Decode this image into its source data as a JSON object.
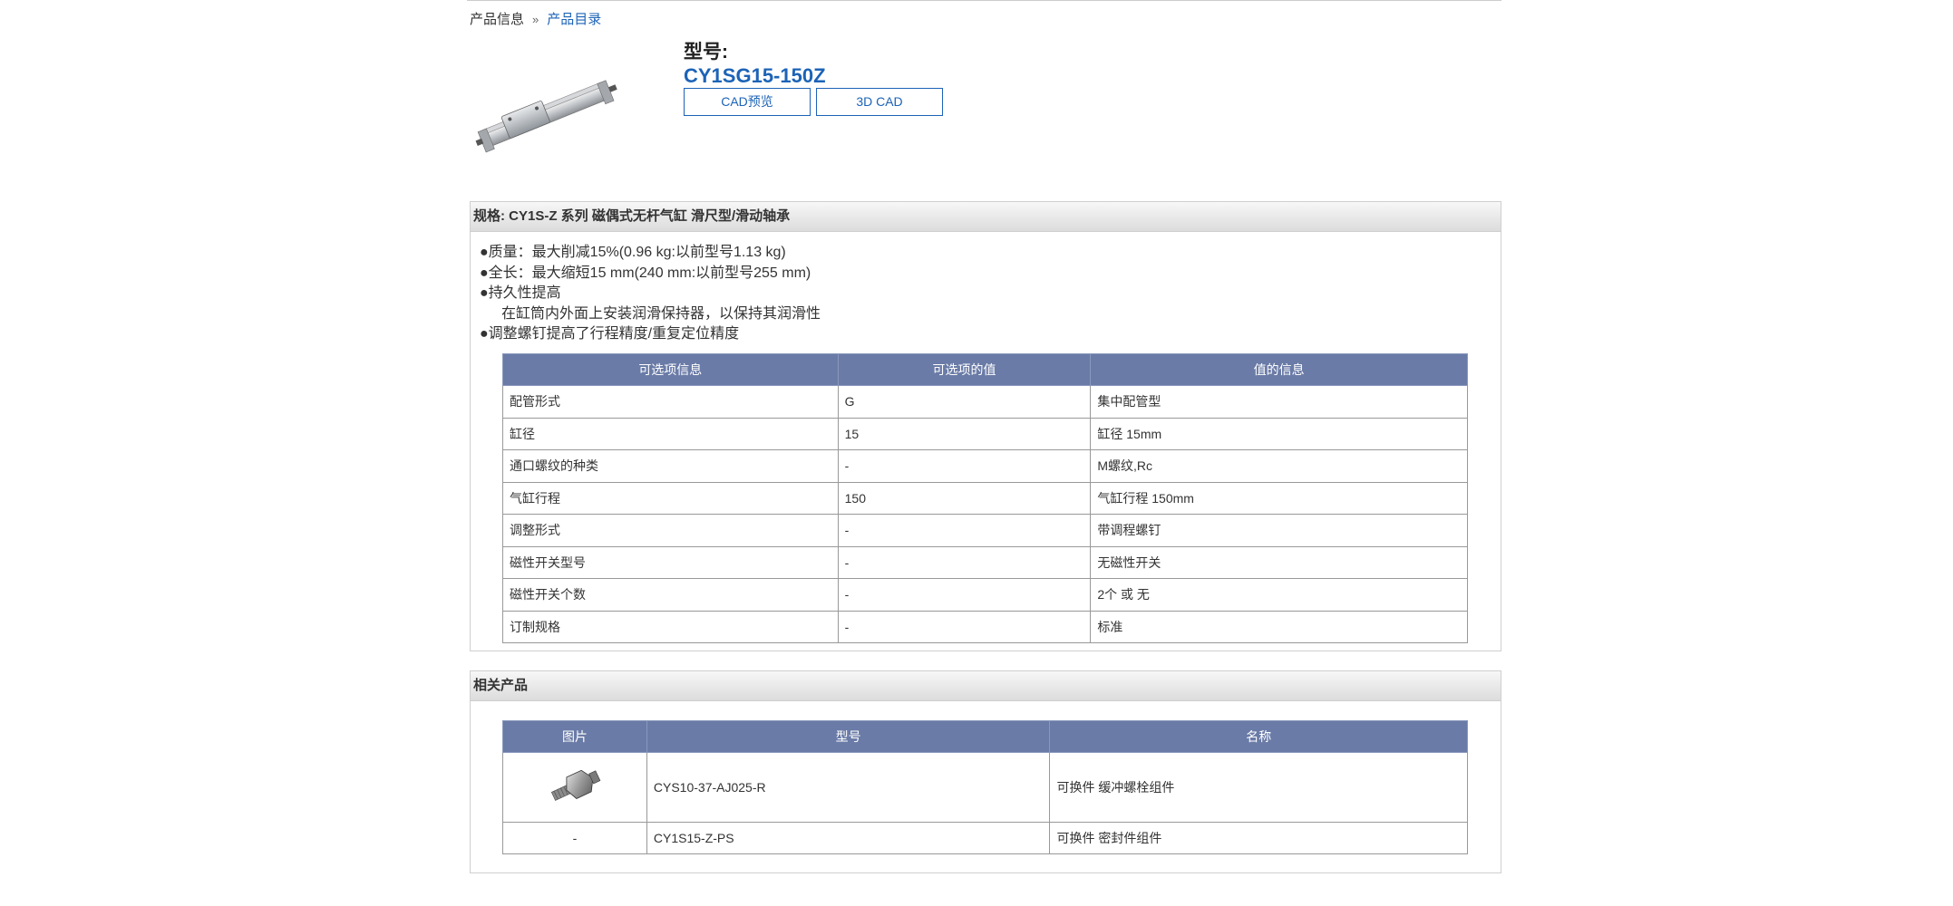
{
  "breadcrumb": {
    "item1": "产品信息",
    "separator": "»",
    "item2": "产品目录"
  },
  "product": {
    "model_label": "型号:",
    "model_number": "CY1SG15-150Z",
    "buttons": {
      "cad_preview": "CAD预览",
      "cad_3d": "3D CAD"
    }
  },
  "spec": {
    "header": "规格: CY1S-Z 系列 磁偶式无杆气缸 滑尺型/滑动轴承",
    "features": [
      "●质量：最大削减15%(0.96 kg:以前型号1.13 kg)",
      "●全长：最大缩短15 mm(240 mm:以前型号255 mm)",
      "●持久性提高",
      "在缸筒内外面上安装润滑保持器，以保持其润滑性",
      "●调整螺钉提高了行程精度/重复定位精度"
    ],
    "table": {
      "headers": [
        "可选项信息",
        "可选项的值",
        "值的信息"
      ],
      "rows": [
        [
          "配管形式",
          "G",
          "集中配管型"
        ],
        [
          "缸径",
          "15",
          "缸径 15mm"
        ],
        [
          "通口螺纹的种类",
          "-",
          "M螺纹,Rc"
        ],
        [
          "气缸行程",
          "150",
          "气缸行程 150mm"
        ],
        [
          "调整形式",
          "-",
          "带调程螺钉"
        ],
        [
          "磁性开关型号",
          "-",
          "无磁性开关"
        ],
        [
          "磁性开关个数",
          "-",
          "2个 或 无"
        ],
        [
          "订制规格",
          "-",
          "标准"
        ]
      ]
    }
  },
  "related": {
    "header": "相关产品",
    "table": {
      "headers": [
        "图片",
        "型号",
        "名称"
      ],
      "rows": [
        {
          "image": "bolt-part-image",
          "model": "CYS10-37-AJ025-R",
          "name": "可换件 缓冲螺栓组件"
        },
        {
          "image": "-",
          "model": "CY1S15-Z-PS",
          "name": "可换件 密封件组件"
        }
      ]
    }
  },
  "colors": {
    "accent": "#1c63b7",
    "table_header": "#6a7ba7",
    "panel_header": "#e4e4e4"
  }
}
